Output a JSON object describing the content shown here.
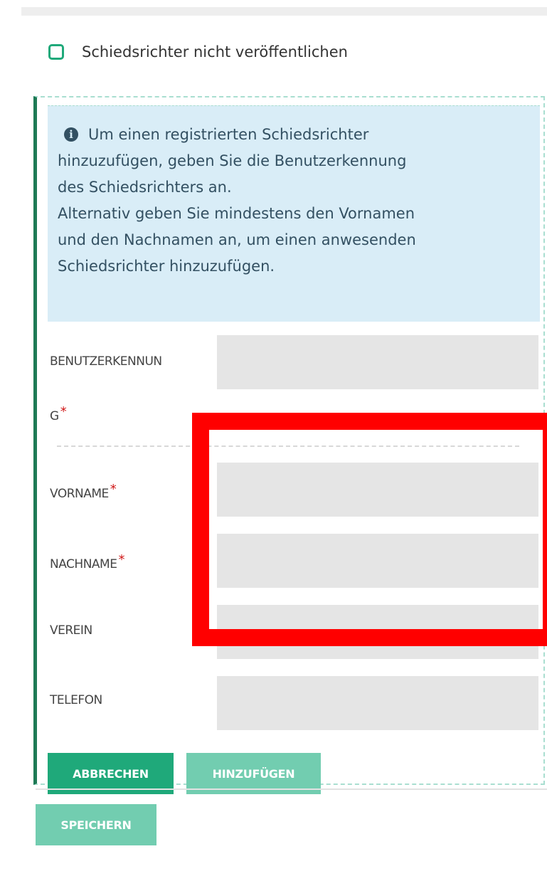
{
  "checkbox": {
    "label": "Schiedsrichter nicht veröffentlichen",
    "checked": false
  },
  "info": {
    "icon": "info-icon",
    "lines": [
      "Um einen registrierten Schiedsrichter",
      "hinzuzufügen, geben Sie die Benutzerkennung",
      "des Schiedsrichters an.",
      "Alternativ geben Sie mindestens den Vornamen",
      "und den Nachnamen an, um einen anwesenden",
      "Schiedsrichter hinzuzufügen."
    ]
  },
  "fields": {
    "benutzerkennung": {
      "label_part1": "BENUTZERKENNUN",
      "label_part2": "G",
      "required": "*",
      "value": ""
    },
    "vorname": {
      "label": "VORNAME",
      "required": "*",
      "value": ""
    },
    "nachname": {
      "label": "NACHNAME",
      "required": "*",
      "value": ""
    },
    "verein": {
      "label": "VEREIN",
      "value": ""
    },
    "telefon": {
      "label": "TELEFON",
      "value": ""
    }
  },
  "buttons": {
    "cancel": "ABBRECHEN",
    "add": "HINZUFÜGEN",
    "save": "SPEICHERN"
  },
  "colors": {
    "primary": "#1fa97a",
    "primary_light": "#72cdb0",
    "info_bg": "#d9edf7",
    "input_bg": "#e5e5e5",
    "required": "#d01818",
    "highlight": "#ff0000"
  }
}
